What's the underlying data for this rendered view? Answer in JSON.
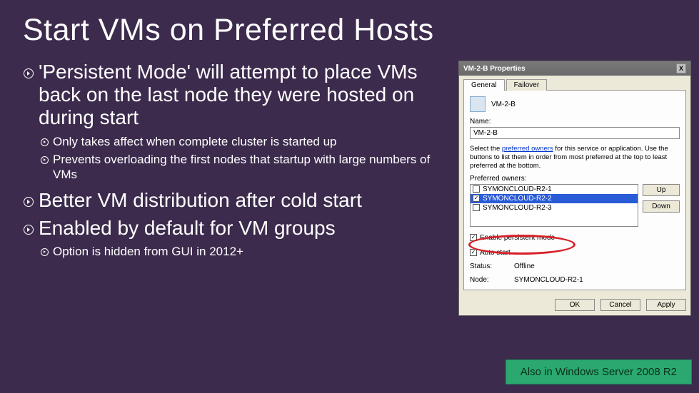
{
  "title": "Start VMs on Preferred Hosts",
  "bullets": {
    "b1": "'Persistent Mode' will attempt to place VMs back on the last node they were hosted on during start",
    "b1a": "Only takes affect when complete cluster is started up",
    "b1b": "Prevents overloading the first nodes that startup with large numbers of VMs",
    "b2": "Better VM distribution after cold start",
    "b3": "Enabled by default for VM groups",
    "b3a": "Option is hidden from GUI in 2012+"
  },
  "dialog": {
    "title": "VM-2-B Properties",
    "close": "X",
    "tabs": {
      "general": "General",
      "failover": "Failover"
    },
    "vm_label": "VM-2-B",
    "name_label": "Name:",
    "name_value": "VM-2-B",
    "help_pre": "Select the ",
    "help_link": "preferred owners",
    "help_post": " for this service or application. Use the buttons to list them in order from most preferred at the top to least preferred at the bottom.",
    "po_label": "Preferred owners:",
    "owners": [
      {
        "checked": false,
        "name": "SYMONCLOUD-R2-1"
      },
      {
        "checked": true,
        "name": "SYMONCLOUD-R2-2"
      },
      {
        "checked": false,
        "name": "SYMONCLOUD-R2-3"
      }
    ],
    "btn_up": "Up",
    "btn_down": "Down",
    "chk_persistent": "Enable persistent mode",
    "chk_autostart": "Auto start",
    "status_label": "Status:",
    "status_value": "Offline",
    "node_label": "Node:",
    "node_value": "SYMONCLOUD-R2-1",
    "btn_ok": "OK",
    "btn_cancel": "Cancel",
    "btn_apply": "Apply"
  },
  "footer_badge": "Also in Windows Server 2008 R2"
}
